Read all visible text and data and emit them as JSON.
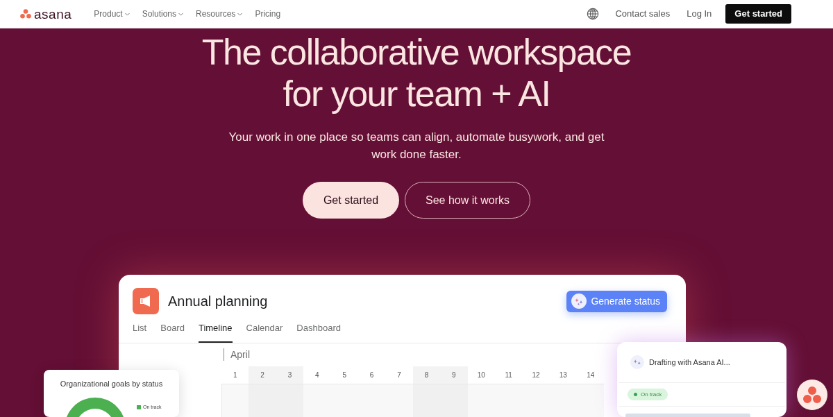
{
  "nav": {
    "logo": "asana",
    "menu": [
      {
        "label": "Product",
        "dropdown": true
      },
      {
        "label": "Solutions",
        "dropdown": true
      },
      {
        "label": "Resources",
        "dropdown": true
      },
      {
        "label": "Pricing",
        "dropdown": false
      }
    ],
    "contact": "Contact sales",
    "login": "Log In",
    "cta": "Get started"
  },
  "hero": {
    "title_lines": [
      "The collaborative workspace",
      "for your team + AI"
    ],
    "subtitle": "Your work in one place so teams can align, automate busywork, and get work done faster.",
    "buttons": [
      {
        "label": "Get started",
        "kind": "primary"
      },
      {
        "label": "See how it works",
        "kind": "outline"
      }
    ]
  },
  "project": {
    "title": "Annual planning",
    "action": "Generate status",
    "tabs": [
      {
        "label": "List",
        "selected": false
      },
      {
        "label": "Board",
        "selected": false
      },
      {
        "label": "Timeline",
        "selected": true
      },
      {
        "label": "Calendar",
        "selected": false
      },
      {
        "label": "Dashboard",
        "selected": false
      }
    ],
    "month": "April",
    "days": [
      {
        "label": "1",
        "weekend": false
      },
      {
        "label": "2",
        "weekend": true
      },
      {
        "label": "3",
        "weekend": true
      },
      {
        "label": "4",
        "weekend": false
      },
      {
        "label": "5",
        "weekend": false
      },
      {
        "label": "6",
        "weekend": false
      },
      {
        "label": "7",
        "weekend": false
      },
      {
        "label": "8",
        "weekend": true
      },
      {
        "label": "9",
        "weekend": true
      },
      {
        "label": "10",
        "weekend": false
      },
      {
        "label": "11",
        "weekend": false
      },
      {
        "label": "12",
        "weekend": false
      },
      {
        "label": "13",
        "weekend": false
      },
      {
        "label": "14",
        "weekend": false
      }
    ]
  },
  "goals_card": {
    "title": "Organizational goals by status",
    "legend": [
      "On track"
    ]
  },
  "ai_card": {
    "title": "Drafting with Asana AI...",
    "status": "On track"
  }
}
